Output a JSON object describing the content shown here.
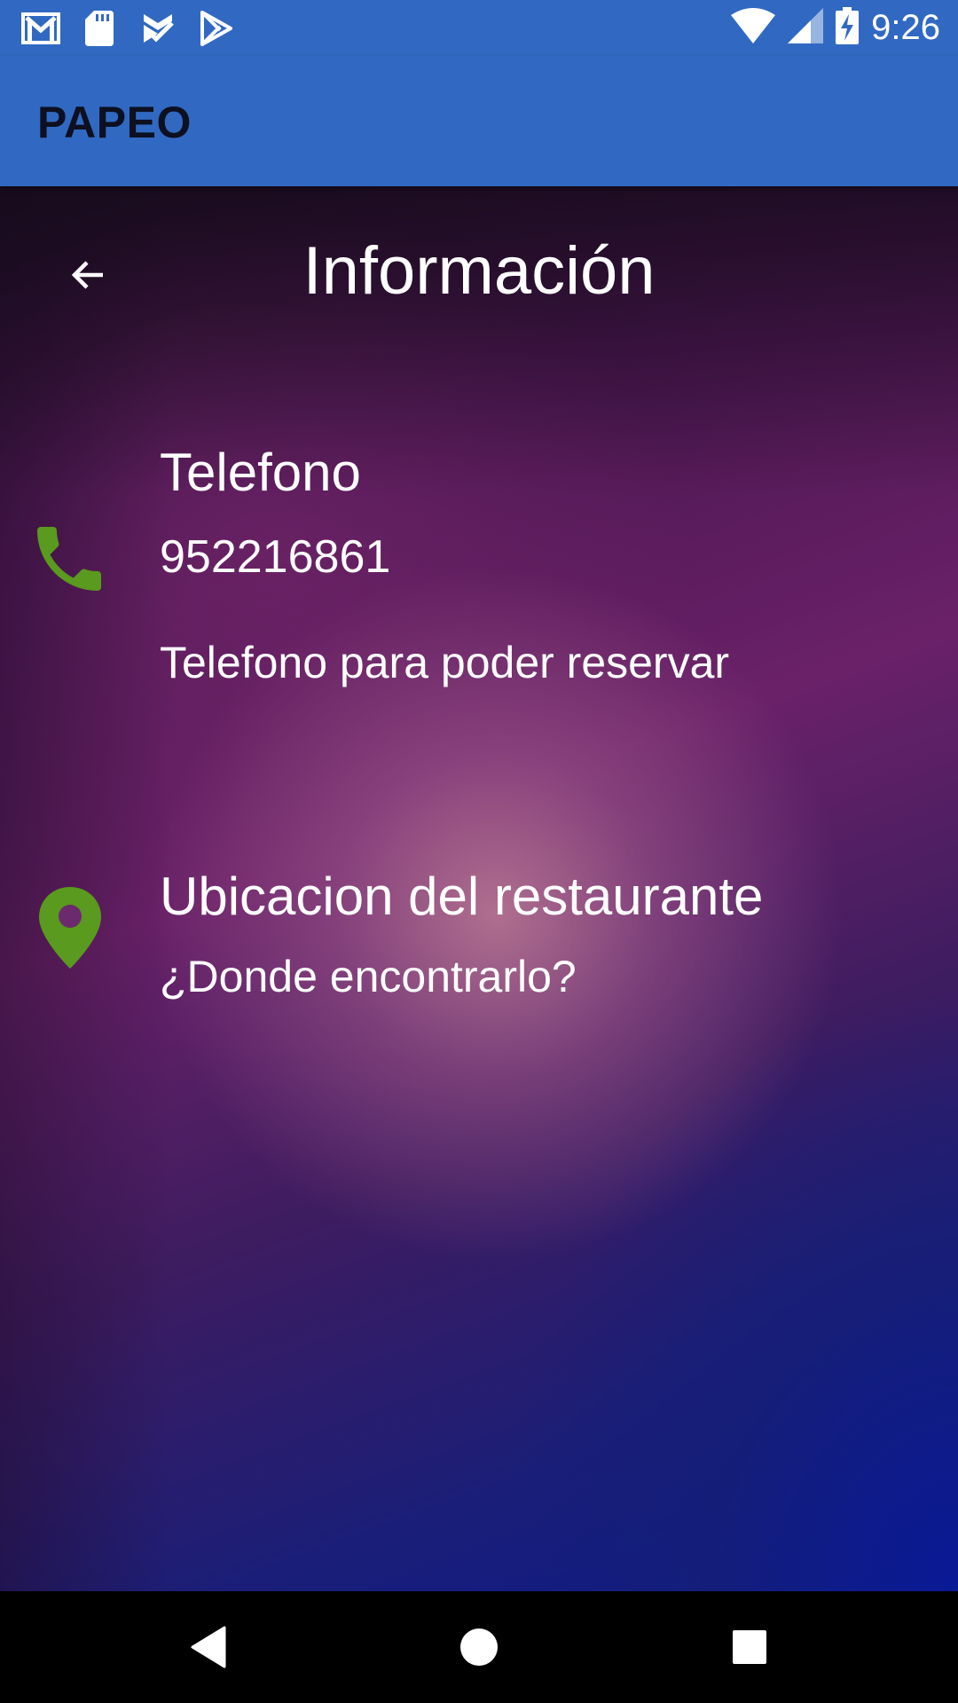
{
  "status_bar": {
    "time": "9:26",
    "icons_left": [
      "gmail-icon",
      "sd-card-icon",
      "tasks-check-icon",
      "play-store-icon"
    ],
    "icons_right": [
      "wifi-icon",
      "signal-icon",
      "battery-charging-icon"
    ]
  },
  "app_bar": {
    "title": "PAPEO"
  },
  "page": {
    "title": "Información",
    "back_icon": "arrow-back-icon"
  },
  "phone": {
    "icon": "phone-icon",
    "label": "Telefono",
    "number": "952216861",
    "description": "Telefono para poder reservar"
  },
  "location": {
    "icon": "location-pin-icon",
    "label": "Ubicacion del restaurante",
    "subtitle": "¿Donde encontrarlo?"
  },
  "nav_bar": {
    "buttons": [
      "back-triangle-icon",
      "home-circle-icon",
      "recents-square-icon"
    ]
  },
  "colors": {
    "app_bar": "#3169c2",
    "icon_green": "#5a9a1e",
    "text": "#ffffff"
  }
}
